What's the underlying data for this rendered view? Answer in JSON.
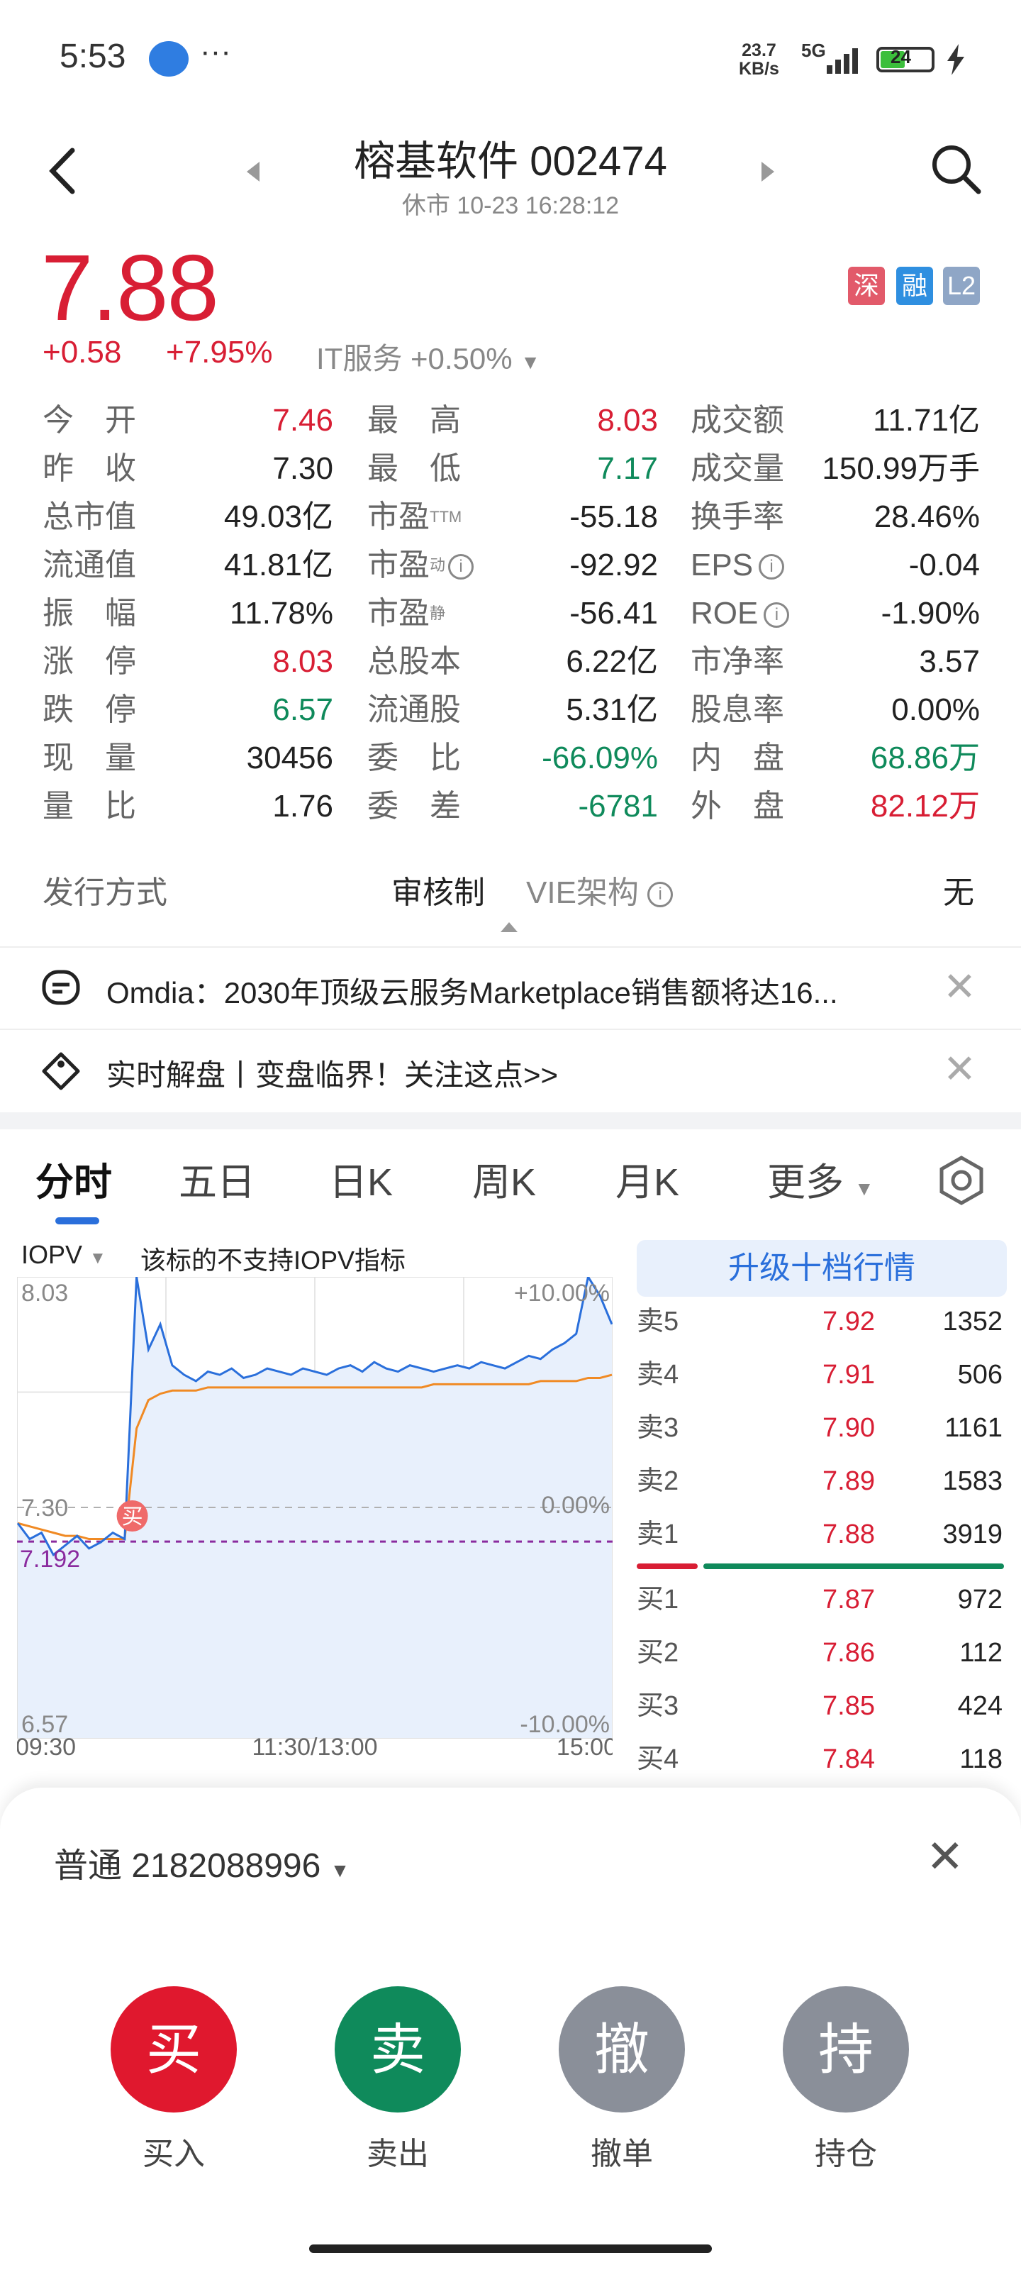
{
  "status_bar": {
    "time": "5:53",
    "dots": "···",
    "net_speed": "23.7",
    "net_unit": "KB/s",
    "signal": "5G",
    "battery": "24"
  },
  "header": {
    "title": "榕基软件 002474",
    "subtitle": "休市 10-23 16:28:12"
  },
  "price": {
    "last": "7.88",
    "change": "+0.58",
    "change_pct": "+7.95%",
    "sector": "IT服务 +0.50%",
    "tags": [
      "深",
      "融",
      "L2"
    ]
  },
  "quote": {
    "col1": [
      {
        "label": "今　开",
        "value": "7.46",
        "color": "red"
      },
      {
        "label": "昨　收",
        "value": "7.30",
        "color": "black"
      },
      {
        "label": "总市值",
        "value": "49.03亿",
        "color": "black"
      },
      {
        "label": "流通值",
        "value": "41.81亿",
        "color": "black"
      },
      {
        "label": "振　幅",
        "value": "11.78%",
        "color": "black"
      },
      {
        "label": "涨　停",
        "value": "8.03",
        "color": "red"
      },
      {
        "label": "跌　停",
        "value": "6.57",
        "color": "green"
      },
      {
        "label": "现　量",
        "value": "30456",
        "color": "black"
      },
      {
        "label": "量　比",
        "value": "1.76",
        "color": "black"
      }
    ],
    "col2": [
      {
        "label": "最　高",
        "sup": "",
        "value": "8.03",
        "color": "red"
      },
      {
        "label": "最　低",
        "sup": "",
        "value": "7.17",
        "color": "green"
      },
      {
        "label": "市盈",
        "sup": "TTM",
        "value": "-55.18",
        "color": "black"
      },
      {
        "label": "市盈",
        "sup": "动",
        "value": "-92.92",
        "color": "black"
      },
      {
        "label": "市盈",
        "sup": "静",
        "value": "-56.41",
        "color": "black"
      },
      {
        "label": "总股本",
        "sup": "",
        "value": "6.22亿",
        "color": "black"
      },
      {
        "label": "流通股",
        "sup": "",
        "value": "5.31亿",
        "color": "black"
      },
      {
        "label": "委　比",
        "sup": "",
        "value": "-66.09%",
        "color": "green"
      },
      {
        "label": "委　差",
        "sup": "",
        "value": "-6781",
        "color": "green"
      }
    ],
    "col3": [
      {
        "label": "成交额",
        "value": "11.71亿",
        "color": "black"
      },
      {
        "label": "成交量",
        "value": "150.99万手",
        "color": "black"
      },
      {
        "label": "换手率",
        "value": "28.46%",
        "color": "black"
      },
      {
        "label": "EPS",
        "value": "-0.04",
        "color": "black"
      },
      {
        "label": "ROE",
        "value": "-1.90%",
        "color": "black"
      },
      {
        "label": "市净率",
        "value": "3.57",
        "color": "black"
      },
      {
        "label": "股息率",
        "value": "0.00%",
        "color": "black"
      },
      {
        "label": "内　盘",
        "value": "68.86万",
        "color": "green"
      },
      {
        "label": "外　盘",
        "value": "82.12万",
        "color": "red"
      }
    ]
  },
  "issue": {
    "label": "发行方式",
    "mode": "审核制",
    "vie_label": "VIE架构",
    "vie_value": "无"
  },
  "news": [
    {
      "text": "Omdia：2030年顶级云服务Marketplace销售额将达16..."
    },
    {
      "text": "实时解盘丨变盘临界！关注这点>>"
    }
  ],
  "tabs": [
    "分时",
    "五日",
    "日K",
    "周K",
    "月K",
    "更多"
  ],
  "chart_panel": {
    "indicator": "IOPV",
    "notice": "该标的不支持IOPV指标",
    "upgrade": "升级十档行情",
    "buy_marker": "买"
  },
  "chart_data": {
    "type": "line",
    "y_left_ticks": [
      "8.03",
      "7.30",
      "6.57"
    ],
    "y_right_ticks": [
      "+10.00%",
      "0.00%",
      "-10.00%"
    ],
    "x_ticks": [
      "09:30",
      "11:30/13:00",
      "15:00"
    ],
    "ylim": [
      6.57,
      8.03
    ],
    "ref_line": {
      "value": 7.192,
      "label": "7.192"
    },
    "series": [
      {
        "color": "#2a6fdb",
        "values": [
          7.25,
          7.2,
          7.22,
          7.15,
          7.18,
          7.21,
          7.17,
          7.19,
          7.22,
          7.2,
          8.03,
          7.8,
          7.88,
          7.75,
          7.72,
          7.7,
          7.73,
          7.72,
          7.74,
          7.71,
          7.72,
          7.74,
          7.73,
          7.72,
          7.74,
          7.73,
          7.72,
          7.74,
          7.75,
          7.73,
          7.76,
          7.74,
          7.73,
          7.75,
          7.74,
          7.73,
          7.74,
          7.75,
          7.74,
          7.76,
          7.75,
          7.74,
          7.76,
          7.78,
          7.77,
          7.8,
          7.82,
          7.85,
          8.03,
          7.97,
          7.88
        ]
      },
      {
        "color": "#f08a24",
        "values": [
          7.25,
          7.24,
          7.23,
          7.22,
          7.21,
          7.21,
          7.2,
          7.2,
          7.2,
          7.2,
          7.55,
          7.64,
          7.66,
          7.67,
          7.67,
          7.67,
          7.68,
          7.68,
          7.68,
          7.68,
          7.68,
          7.68,
          7.68,
          7.68,
          7.68,
          7.68,
          7.68,
          7.68,
          7.68,
          7.68,
          7.68,
          7.68,
          7.68,
          7.68,
          7.68,
          7.69,
          7.69,
          7.69,
          7.69,
          7.69,
          7.69,
          7.69,
          7.69,
          7.69,
          7.7,
          7.7,
          7.7,
          7.7,
          7.71,
          7.71,
          7.72
        ]
      }
    ]
  },
  "order_book": {
    "asks": [
      {
        "label": "卖5",
        "price": "7.92",
        "vol": "1352"
      },
      {
        "label": "卖4",
        "price": "7.91",
        "vol": "506"
      },
      {
        "label": "卖3",
        "price": "7.90",
        "vol": "1161"
      },
      {
        "label": "卖2",
        "price": "7.89",
        "vol": "1583"
      },
      {
        "label": "卖1",
        "price": "7.88",
        "vol": "3919"
      }
    ],
    "bids": [
      {
        "label": "买1",
        "price": "7.87",
        "vol": "972"
      },
      {
        "label": "买2",
        "price": "7.86",
        "vol": "112"
      },
      {
        "label": "买3",
        "price": "7.85",
        "vol": "424"
      },
      {
        "label": "买4",
        "price": "7.84",
        "vol": "118"
      }
    ]
  },
  "trade_sheet": {
    "account": "普通 2182088996",
    "actions": [
      {
        "glyph": "买",
        "label": "买入",
        "color": "#e0182e"
      },
      {
        "glyph": "卖",
        "label": "卖出",
        "color": "#0f8a5b"
      },
      {
        "glyph": "撤",
        "label": "撤单",
        "color": "#8a8f99"
      },
      {
        "glyph": "持",
        "label": "持仓",
        "color": "#8a8f99"
      }
    ]
  }
}
